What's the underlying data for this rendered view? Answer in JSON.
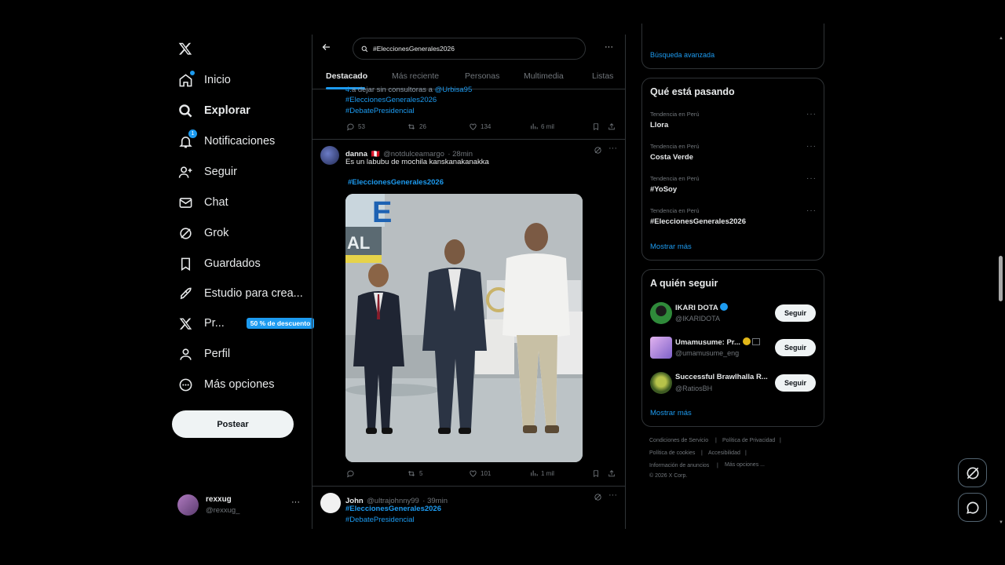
{
  "nav": {
    "items": [
      {
        "label": "Inicio",
        "icon": "home-icon"
      },
      {
        "label": "Explorar",
        "icon": "search-icon"
      },
      {
        "label": "Notificaciones",
        "icon": "bell-icon",
        "badge": "1"
      },
      {
        "label": "Seguir",
        "icon": "person-add-icon"
      },
      {
        "label": "Chat",
        "icon": "mail-icon"
      },
      {
        "label": "Grok",
        "icon": "grok-icon"
      },
      {
        "label": "Guardados",
        "icon": "bookmark-icon"
      },
      {
        "label": "Estudio para crea...",
        "icon": "rocket-icon"
      },
      {
        "label": "Pr...",
        "icon": "x-premium-icon",
        "promo": "50 % de descuento"
      },
      {
        "label": "Perfil",
        "icon": "person-icon"
      },
      {
        "label": "Más opciones",
        "icon": "more-circle-icon"
      }
    ],
    "post_button": "Postear",
    "account": {
      "name": "rexxug",
      "handle": "@rexxug_"
    }
  },
  "search": {
    "query": "#EleccionesGenerales2026"
  },
  "tabs": [
    "Destacado",
    "Más reciente",
    "Personas",
    "Multimedia",
    "Listas"
  ],
  "tweets": [
    {
      "partial_text": "a dejar sin consultoras a",
      "mention": "@Urbisa95",
      "hashtags": [
        "#EleccionesGenerales2026",
        "#DebatePresidencial"
      ],
      "replies": "53",
      "reposts": "26",
      "likes": "134",
      "views": "6 mil"
    },
    {
      "name": "danna",
      "flag": "🇵🇪",
      "handle": "@notdulceamargo",
      "time": "· 28min",
      "text": "Es un labubu de mochila kanskanakanakka",
      "hashtag": "#EleccionesGenerales2026",
      "replies": "",
      "reposts": "5",
      "likes": "101",
      "views": "1 mil"
    },
    {
      "name": "John",
      "handle": "@ultrajohnny99",
      "time": "· 39min",
      "hashtags": [
        "#EleccionesGenerales2026",
        "#DebatePresidencial"
      ]
    }
  ],
  "right": {
    "advanced_search": "Búsqueda avanzada",
    "trending": {
      "title": "Qué está pasando",
      "items": [
        {
          "meta": "Tendencia en Perú",
          "name": "Llora"
        },
        {
          "meta": "Tendencia en Perú",
          "name": "Costa Verde"
        },
        {
          "meta": "Tendencia en Perú",
          "name": "#YoSoy"
        },
        {
          "meta": "Tendencia en Perú",
          "name": "#EleccionesGenerales2026"
        }
      ],
      "show_more": "Mostrar más"
    },
    "who_to_follow": {
      "title": "A quién seguir",
      "items": [
        {
          "name": "IKARI DOTA",
          "handle": "@IKARIDOTA",
          "button": "Seguir",
          "color": "#2f8a3a"
        },
        {
          "name": "Umamusume: Pr...",
          "handle": "@umamusume_eng",
          "button": "Seguir",
          "color": "#c58fe0"
        },
        {
          "name": "Successful Brawlhalla R...",
          "handle": "@RatiosBH",
          "button": "Seguir",
          "color": "#4c6b2e"
        }
      ],
      "show_more": "Mostrar más"
    },
    "footer": {
      "links": [
        "Condiciones de Servicio",
        "Política de Privacidad",
        "Política de cookies",
        "Accesibilidad",
        "Información de anuncios",
        "Más opciones ..."
      ],
      "copyright": "© 2026 X Corp."
    }
  },
  "colors": {
    "accent": "#1d9bf0",
    "background": "#000000",
    "border": "#2f3336",
    "muted": "#71767b"
  }
}
